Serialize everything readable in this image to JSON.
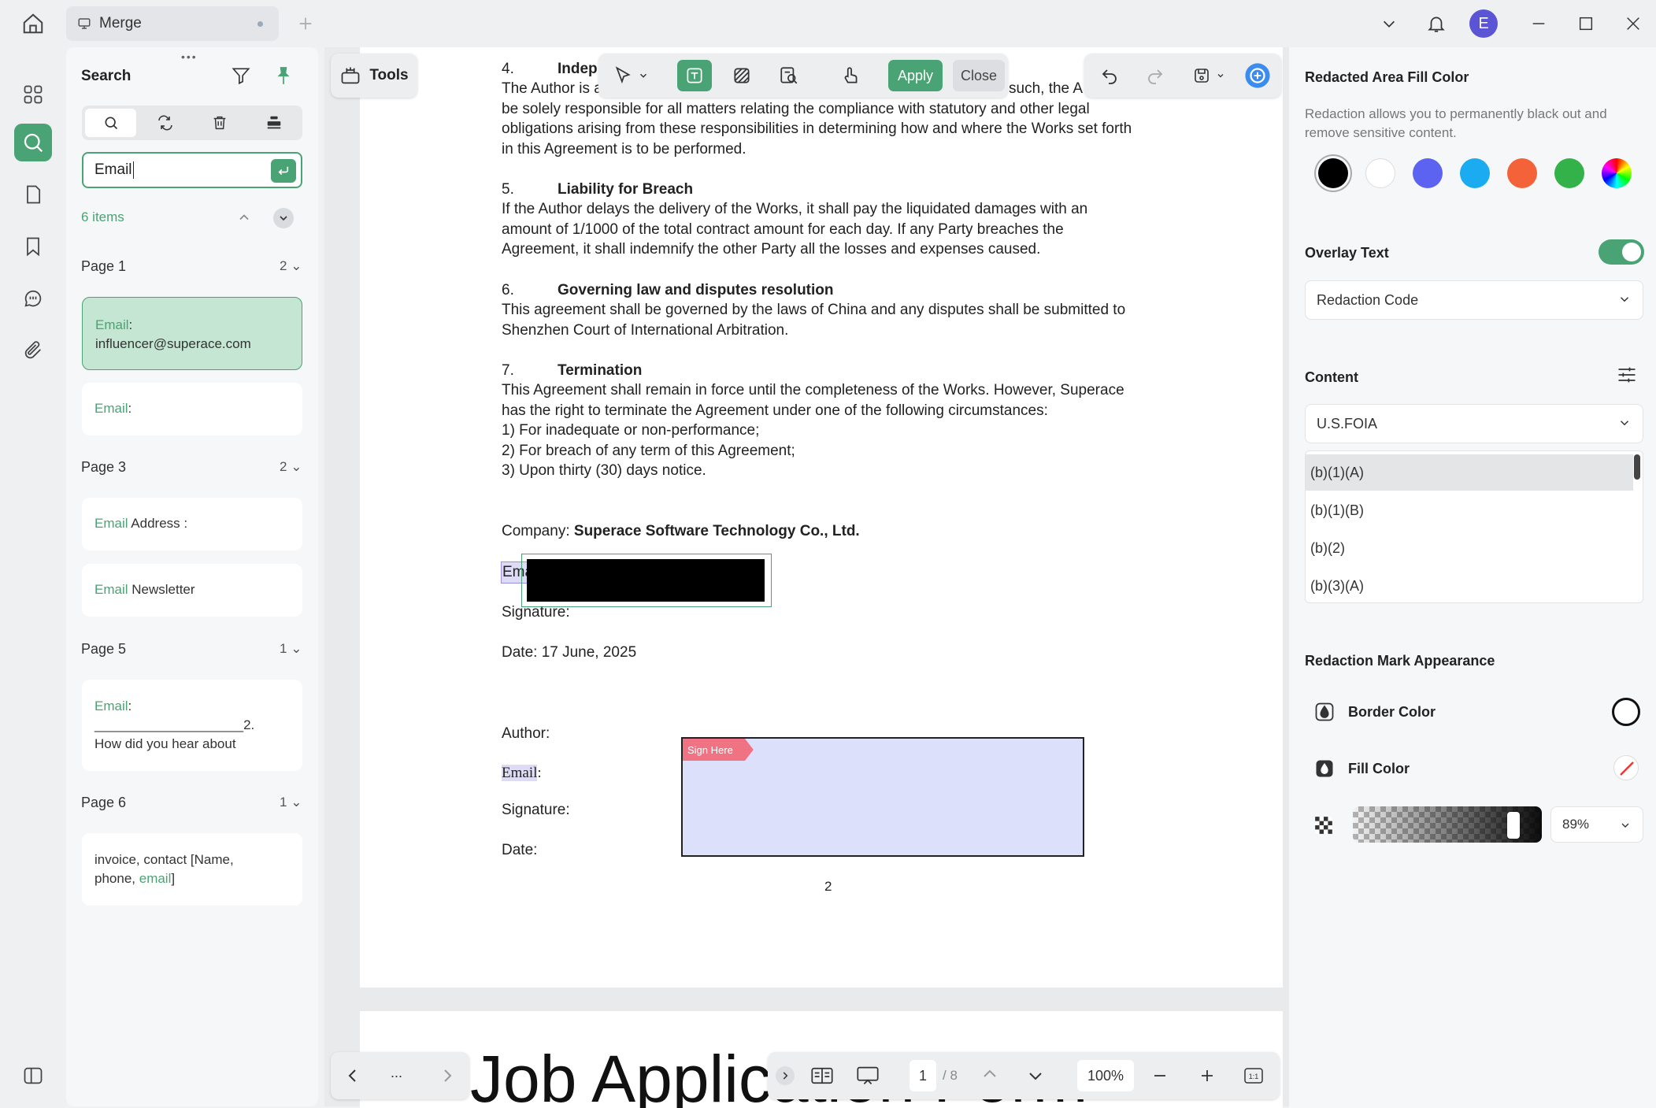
{
  "tab": {
    "title": "Merge"
  },
  "user": {
    "initial": "E"
  },
  "tools": {
    "label": "Tools"
  },
  "redaction_toolbar": {
    "apply": "Apply",
    "close": "Close"
  },
  "search": {
    "title": "Search",
    "query": "Email",
    "count": "6 items",
    "groups": [
      {
        "page": "Page 1",
        "count": "2",
        "results": [
          {
            "hit": "Email",
            "text": ":\ninfluencer@superace.com"
          },
          {
            "hit": "Email",
            "text": ":"
          }
        ]
      },
      {
        "page": "Page 3",
        "count": "2",
        "results": [
          {
            "hit": "Email",
            "text": " Address :"
          },
          {
            "hit": "Email",
            "text": " Newsletter"
          }
        ]
      },
      {
        "page": "Page 5",
        "count": "1",
        "results": [
          {
            "hit": "Email",
            "text": ":\n____________________2.\nHow did you hear about"
          }
        ]
      },
      {
        "page": "Page 6",
        "count": "1",
        "results": [
          {
            "pre": "invoice, contact [Name,\nphone, ",
            "hit": "email",
            "text": "]"
          }
        ]
      }
    ]
  },
  "document": {
    "s4_num": "4.",
    "s4_title": "Indep",
    "s4_line1a": "The Author is a",
    "s4_line1b": "such, the A",
    "s4_lines": [
      "be solely responsible for all matters relating the compliance with statutory and other legal",
      "obligations arising from these responsibilities in determining how and where the Works set forth",
      "in this Agreement is to be performed."
    ],
    "s5_num": "5.",
    "s5_title": "Liability for Breach",
    "s5_lines": [
      "If the Author delays the delivery of the Works, it shall pay the liquidated damages with an",
      "amount of 1/1000 of the total contract amount for each day. If any Party breaches the",
      "Agreement, it shall indemnify the other Party all the losses and expenses caused."
    ],
    "s6_num": "6.",
    "s6_title": "Governing law and disputes resolution",
    "s6_lines": [
      "This agreement shall be governed by the laws of China and any disputes shall be submitted to",
      "Shenzhen Court of International Arbitration."
    ],
    "s7_num": "7.",
    "s7_title": "Termination",
    "s7_lines": [
      "This Agreement shall remain in force until the completeness of the Works. However, Superace",
      "has the right to terminate the Agreement under one of the following circumstances:",
      "1) For inadequate or non-performance;",
      "2) For breach of any term of this Agreement;",
      "3)  Upon thirty (30) days notice."
    ],
    "company_label": "Company:",
    "company_name": "Superace Software Technology Co., Ltd.",
    "email_partial": "Ema",
    "signature_label": "Signature:",
    "date_line": "Date: 17 June, 2025",
    "author_label": "Author:",
    "email_label": "Email",
    "email_colon": ":",
    "signature2_label": "Signature:",
    "date2_label": "Date:",
    "sign_here": "Sign Here",
    "page_number": "2",
    "next_page_title": "Job Application Form"
  },
  "navigation": {
    "more": "...",
    "current_page": "1",
    "total_pages": "/ 8",
    "zoom": "100%"
  },
  "right_panel": {
    "fill_title": "Redacted Area Fill Color",
    "fill_desc_1": "Redaction allows you to permanently black out and",
    "fill_desc_2": "remove sensitive content.",
    "swatches": [
      "#000000",
      "#ffffff",
      "#5b63f0",
      "#1aabf0",
      "#f4623a",
      "#33b249",
      "rainbow"
    ],
    "overlay_title": "Overlay Text",
    "overlay_enabled": true,
    "overlay_select": "Redaction Code",
    "content_title": "Content",
    "content_select": "U.S.FOIA",
    "codes": [
      "(b)(1)(A)",
      "(b)(1)(B)",
      "(b)(2)",
      "(b)(3)(A)"
    ],
    "appearance_title": "Redaction Mark Appearance",
    "border_color_label": "Border Color",
    "fill_color_label": "Fill Color",
    "opacity": "89%"
  },
  "colors": {
    "accent": "#4aa374",
    "redaction": "#000000",
    "sign_tag": "#f07384",
    "sign_box": "#dde0fb"
  }
}
